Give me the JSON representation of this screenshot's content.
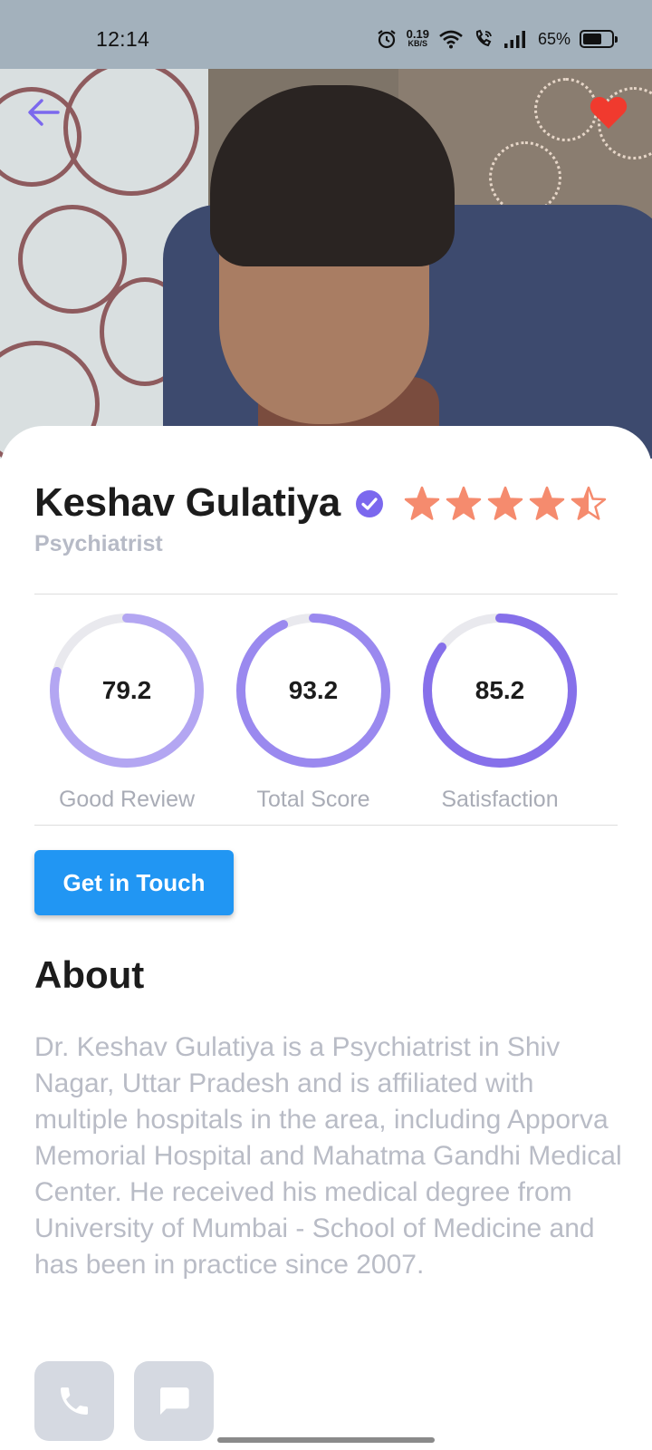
{
  "status_bar": {
    "time": "12:14",
    "net_speed_value": "0.19",
    "net_speed_unit": "KB/S",
    "battery_percent": "65%",
    "battery_level": 0.65
  },
  "header": {
    "back_icon": "arrow-left-icon",
    "favorite_icon": "heart-icon",
    "favorite_color": "#f03a2e"
  },
  "doctor": {
    "name": "Keshav Gulatiya",
    "specialty": "Psychiatrist",
    "verified": true,
    "rating": 4.5,
    "rating_max": 5,
    "star_color": "#f58b6e",
    "verified_color": "#7b68ee"
  },
  "metrics": [
    {
      "value": "79.2",
      "label": "Good Review",
      "progress": 0.792,
      "color": "#b3a6f2"
    },
    {
      "value": "93.2",
      "label": "Total Score",
      "progress": 0.932,
      "color": "#9a89ef"
    },
    {
      "value": "85.2",
      "label": "Satisfaction",
      "progress": 0.852,
      "color": "#8670ea"
    }
  ],
  "cta": {
    "label": "Get in Touch",
    "color": "#2196f3"
  },
  "about": {
    "title": "About",
    "text": "Dr. Keshav Gulatiya is a Psychiatrist in Shiv Nagar, Uttar Pradesh and is affiliated with multiple hospitals in the area, including Apporva Memorial Hospital and Mahatma Gandhi Medical Center. He received his medical degree from University of Mumbai - School of Medicine and has been in practice since 2007."
  },
  "actions": [
    {
      "icon": "phone-icon"
    },
    {
      "icon": "chat-icon"
    }
  ]
}
